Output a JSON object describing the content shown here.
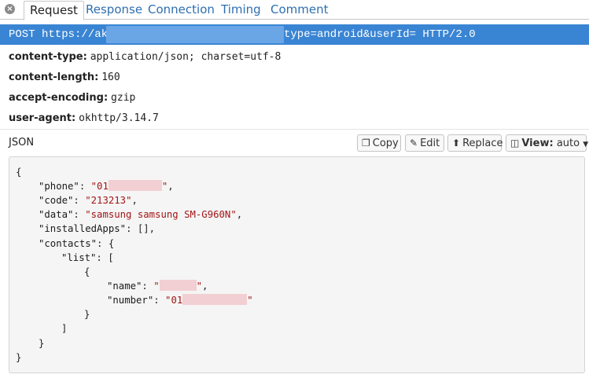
{
  "tabs": {
    "close_glyph": "×",
    "items": [
      {
        "label": "Request",
        "active": true
      },
      {
        "label": "Response",
        "active": false
      },
      {
        "label": "Connection",
        "active": false
      },
      {
        "label": "Timing",
        "active": false
      },
      {
        "label": "Comment",
        "active": false
      }
    ]
  },
  "request_line": {
    "prefix": "POST https://ak.",
    "suffix": "type=android&userId= HTTP/2.0"
  },
  "headers": [
    {
      "key": "content-type",
      "value": "application/json; charset=utf-8"
    },
    {
      "key": "content-length",
      "value": "160"
    },
    {
      "key": "accept-encoding",
      "value": "gzip"
    },
    {
      "key": "user-agent",
      "value": "okhttp/3.14.7"
    }
  ],
  "body": {
    "label": "JSON",
    "copy_label": "Copy",
    "edit_label": "Edit",
    "replace_label": "Replace",
    "view_label": "View:",
    "view_value": "auto"
  },
  "json": {
    "phone_prefix": "01",
    "code": "213213",
    "data": "samsung samsung SM-G960N",
    "number_prefix": "01"
  },
  "colors": {
    "accent": "#3a85d3",
    "link": "#2e6fb0",
    "string": "#a31515"
  }
}
